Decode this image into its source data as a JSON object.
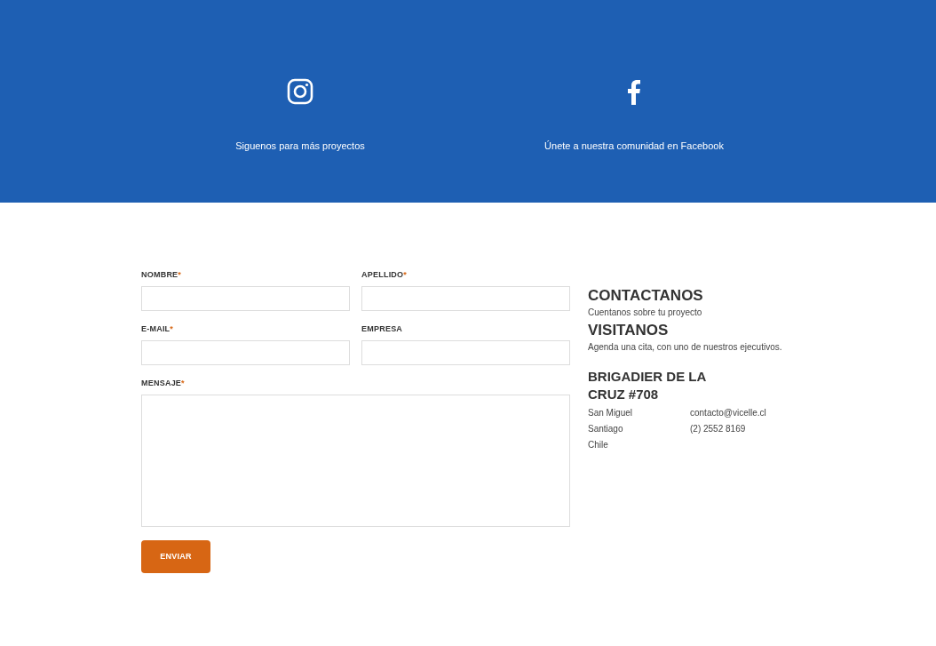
{
  "social": [
    {
      "kind": "instagram",
      "label": "Siguenos para más proyectos"
    },
    {
      "kind": "facebook",
      "label": "Únete a nuestra comunidad en Facebook"
    }
  ],
  "form": {
    "fields": [
      {
        "label": "NOMBRE",
        "required_mark": "*",
        "kind": "input"
      },
      {
        "label": "APELLIDO",
        "required_mark": "*",
        "kind": "input"
      },
      {
        "label": "E-MAIL",
        "required_mark": "*",
        "kind": "input"
      },
      {
        "label": "EMPRESA",
        "kind": "input"
      },
      {
        "label": "MENSAJE",
        "required_mark": "*",
        "kind": "textarea"
      }
    ],
    "submit": "ENVIAR"
  },
  "contact": {
    "blocks": [
      {
        "heading": "CONTACTANOS",
        "text": "Cuentanos sobre tu proyecto"
      },
      {
        "heading": "VISITANOS",
        "text": "Agenda una cita, con uno de nuestros ejecutivos."
      }
    ],
    "address_heading": "BRIGADIER DE LA CRUZ #708",
    "address_lines": [
      "San Miguel",
      "Santiago",
      "Chile"
    ],
    "contact_lines": [
      "contacto@vicelle.cl",
      "(2) 2552 8169"
    ]
  }
}
